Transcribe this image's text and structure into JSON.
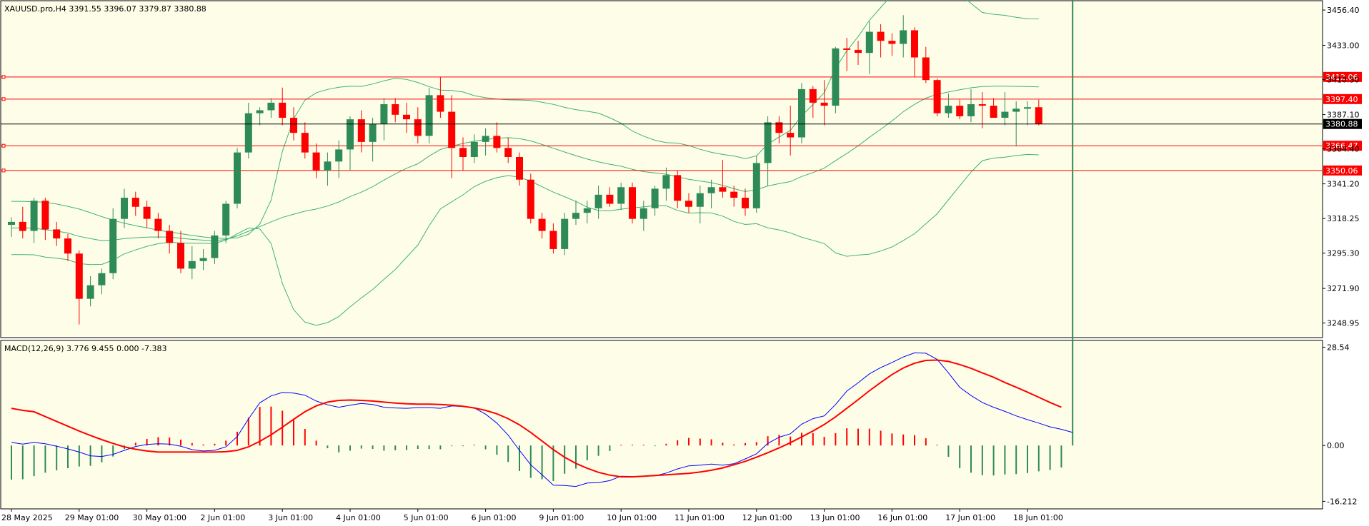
{
  "window": {
    "symbol_info": "XAUUSD.pro,H4  3391.55 3396.07 3379.87 3380.88",
    "macd_info": "MACD(12,26,9) 3.776 9.455 0.000 -7.383"
  },
  "colors": {
    "background": "#fefee8",
    "bull": "#2e8b57",
    "bear": "#ff0000",
    "band": "#3cb371",
    "level": "#ff0000",
    "price_line": "#000000",
    "macd_line": "#0000ff",
    "signal_line": "#ff0000"
  },
  "chart_data": [
    {
      "type": "candlestick",
      "title": "XAUUSD.pro,H4",
      "ylim": [
        3239.3,
        3462.6
      ],
      "y_ticks": [
        "3456.40",
        "3433.00",
        "3410.30",
        "3387.10",
        "3364.40",
        "3341.20",
        "3318.25",
        "3295.30",
        "3271.90",
        "3248.95"
      ],
      "x_ticks": [
        "28 May 2025",
        "29 May 01:00",
        "30 May 01:00",
        "2 Jun 01:00",
        "3 Jun 01:00",
        "4 Jun 01:00",
        "5 Jun 01:00",
        "6 Jun 01:00",
        "9 Jun 01:00",
        "10 Jun 01:00",
        "11 Jun 01:00",
        "12 Jun 01:00",
        "13 Jun 01:00",
        "16 Jun 01:00",
        "17 Jun 01:00",
        "18 Jun 01:00"
      ],
      "candles": [
        [
          3314,
          3319,
          3306,
          3316
        ],
        [
          3316,
          3326,
          3305,
          3310
        ],
        [
          3310,
          3332,
          3302,
          3330
        ],
        [
          3330,
          3332,
          3304,
          3311
        ],
        [
          3311,
          3316,
          3300,
          3305
        ],
        [
          3305,
          3308,
          3290,
          3295
        ],
        [
          3295,
          3297,
          3248,
          3265
        ],
        [
          3265,
          3280,
          3260,
          3274
        ],
        [
          3274,
          3285,
          3268,
          3282
        ],
        [
          3282,
          3325,
          3278,
          3318
        ],
        [
          3318,
          3338,
          3312,
          3332
        ],
        [
          3332,
          3336,
          3320,
          3326
        ],
        [
          3326,
          3330,
          3312,
          3318
        ],
        [
          3318,
          3322,
          3305,
          3310
        ],
        [
          3310,
          3314,
          3295,
          3302
        ],
        [
          3302,
          3310,
          3282,
          3285
        ],
        [
          3285,
          3300,
          3278,
          3290
        ],
        [
          3290,
          3298,
          3284,
          3292
        ],
        [
          3292,
          3310,
          3288,
          3307
        ],
        [
          3307,
          3330,
          3302,
          3328
        ],
        [
          3328,
          3365,
          3325,
          3362
        ],
        [
          3362,
          3395,
          3358,
          3388
        ],
        [
          3388,
          3392,
          3380,
          3390
        ],
        [
          3390,
          3398,
          3385,
          3395
        ],
        [
          3395,
          3405,
          3380,
          3385
        ],
        [
          3385,
          3392,
          3370,
          3375
        ],
        [
          3375,
          3382,
          3358,
          3362
        ],
        [
          3362,
          3368,
          3345,
          3350
        ],
        [
          3350,
          3362,
          3340,
          3356
        ],
        [
          3356,
          3370,
          3345,
          3364
        ],
        [
          3364,
          3386,
          3350,
          3384
        ],
        [
          3384,
          3390,
          3362,
          3369
        ],
        [
          3369,
          3385,
          3356,
          3381
        ],
        [
          3381,
          3398,
          3370,
          3394
        ],
        [
          3394,
          3398,
          3382,
          3387
        ],
        [
          3387,
          3395,
          3375,
          3384
        ],
        [
          3384,
          3392,
          3368,
          3373
        ],
        [
          3373,
          3405,
          3368,
          3400
        ],
        [
          3400,
          3412,
          3385,
          3389
        ],
        [
          3389,
          3400,
          3345,
          3365
        ],
        [
          3365,
          3372,
          3350,
          3359
        ],
        [
          3359,
          3374,
          3355,
          3369
        ],
        [
          3369,
          3378,
          3360,
          3373
        ],
        [
          3373,
          3382,
          3362,
          3365
        ],
        [
          3365,
          3372,
          3355,
          3359
        ],
        [
          3359,
          3362,
          3340,
          3344
        ],
        [
          3344,
          3348,
          3315,
          3318
        ],
        [
          3318,
          3322,
          3305,
          3310
        ],
        [
          3310,
          3315,
          3295,
          3298
        ],
        [
          3298,
          3322,
          3294,
          3318
        ],
        [
          3318,
          3330,
          3314,
          3322
        ],
        [
          3322,
          3330,
          3315,
          3325
        ],
        [
          3325,
          3340,
          3318,
          3334
        ],
        [
          3334,
          3339,
          3326,
          3328
        ],
        [
          3328,
          3342,
          3324,
          3339
        ],
        [
          3339,
          3342,
          3315,
          3318
        ],
        [
          3318,
          3330,
          3310,
          3325
        ],
        [
          3325,
          3340,
          3320,
          3338
        ],
        [
          3338,
          3352,
          3330,
          3347
        ],
        [
          3347,
          3350,
          3325,
          3330
        ],
        [
          3330,
          3335,
          3322,
          3326
        ],
        [
          3326,
          3340,
          3315,
          3335
        ],
        [
          3335,
          3344,
          3325,
          3339
        ],
        [
          3339,
          3357,
          3332,
          3336
        ],
        [
          3336,
          3340,
          3326,
          3332
        ],
        [
          3332,
          3338,
          3320,
          3325
        ],
        [
          3325,
          3360,
          3322,
          3355
        ],
        [
          3355,
          3386,
          3340,
          3382
        ],
        [
          3382,
          3386,
          3368,
          3375
        ],
        [
          3375,
          3393,
          3360,
          3372
        ],
        [
          3372,
          3408,
          3368,
          3404
        ],
        [
          3404,
          3406,
          3385,
          3395
        ],
        [
          3395,
          3410,
          3380,
          3393
        ],
        [
          3393,
          3432,
          3388,
          3431
        ],
        [
          3431,
          3438,
          3416,
          3430
        ],
        [
          3430,
          3436,
          3420,
          3428
        ],
        [
          3428,
          3449,
          3414,
          3442
        ],
        [
          3442,
          3447,
          3425,
          3436
        ],
        [
          3436,
          3441,
          3426,
          3434
        ],
        [
          3434,
          3453,
          3425,
          3443
        ],
        [
          3443,
          3445,
          3412,
          3425
        ],
        [
          3425,
          3432,
          3408,
          3410
        ],
        [
          3410,
          3411,
          3386,
          3388
        ],
        [
          3388,
          3401,
          3385,
          3393
        ],
        [
          3393,
          3397,
          3384,
          3386
        ],
        [
          3386,
          3404,
          3382,
          3394
        ],
        [
          3394,
          3402,
          3378,
          3393
        ],
        [
          3393,
          3398,
          3385,
          3385
        ],
        [
          3385,
          3402,
          3380,
          3389
        ],
        [
          3389,
          3396,
          3366,
          3391
        ],
        [
          3391,
          3396,
          3380,
          3392
        ],
        [
          3392,
          3397,
          3380,
          3381
        ]
      ],
      "bollinger": {
        "upper": [
          3329.6,
          3329.6,
          3329.3,
          3329,
          3327.8,
          3326.3,
          3324.5,
          3322.1,
          3319.5,
          3317.1,
          3315.1,
          3313.5,
          3312,
          3310.5,
          3309.3,
          3308.2,
          3307,
          3306,
          3305.3,
          3305,
          3305.4,
          3307.7,
          3314.5,
          3330.3,
          3362.7,
          3384.4,
          3396.7,
          3401.6,
          3403.8,
          3405.2,
          3405.9,
          3405.8,
          3407.4,
          3409.5,
          3411.2,
          3410.4,
          3408.4,
          3405.7,
          3403.3,
          3403.1,
          3402.1,
          3399.7,
          3398.3,
          3397.4,
          3396.9,
          3396.8,
          3396.5,
          3395.3,
          3393.9,
          3391.9,
          3390.4,
          3389.3,
          3388.1,
          3385,
          3381.4,
          3376.2,
          3372.8,
          3370.1,
          3368.5,
          3368.2,
          3366.6,
          3364.1,
          3362.1,
          3360.7,
          3359.7,
          3357.9,
          3359.8,
          3367.6,
          3372.2,
          3376.7,
          3386.4,
          3393.7,
          3401.6,
          3417.8,
          3429.4,
          3438.8,
          3449.6,
          3458.1,
          3466.4,
          3474.4,
          3479.7,
          3481.3,
          3479.8,
          3473.6,
          3467.3,
          3460.8,
          3454.8,
          3453.6,
          3452.9,
          3451.6,
          3450.7,
          3450.6
        ],
        "middle": [
          3311.9,
          3312,
          3311.8,
          3310.8,
          3309.9,
          3308.6,
          3306.4,
          3304.9,
          3303.6,
          3303.9,
          3304.9,
          3305.5,
          3305.9,
          3306,
          3305.9,
          3305.1,
          3304.4,
          3303.9,
          3303.5,
          3304.4,
          3306.7,
          3309.8,
          3312.9,
          3316,
          3318.9,
          3321.1,
          3323.1,
          3324.5,
          3326.5,
          3329.2,
          3332.8,
          3335.7,
          3339.3,
          3343.7,
          3347.8,
          3351.5,
          3354.5,
          3359.6,
          3364,
          3366.2,
          3368,
          3369.5,
          3370.6,
          3371.4,
          3371.8,
          3371.2,
          3369.7,
          3367.3,
          3364.8,
          3362.3,
          3359.9,
          3357.6,
          3355.8,
          3354.2,
          3352.9,
          3350.8,
          3349.3,
          3348.5,
          3347.6,
          3345.9,
          3344.2,
          3343.1,
          3342,
          3340.2,
          3338,
          3336.1,
          3337.3,
          3339.8,
          3341.4,
          3342.7,
          3346.1,
          3348.7,
          3351.6,
          3356.6,
          3361.3,
          3366.4,
          3372.1,
          3377.4,
          3382.9,
          3389,
          3393.9,
          3398,
          3400.6,
          3402.1,
          3403.6,
          3404.9,
          3405.7,
          3405.9,
          3405.9,
          3405.8,
          3405.7,
          3405.5
        ],
        "lower": [
          3294.3,
          3294.3,
          3294.2,
          3292.6,
          3291.9,
          3290.9,
          3288.3,
          3287.7,
          3287.8,
          3290.7,
          3294.8,
          3297.4,
          3299.8,
          3301.5,
          3302.5,
          3302,
          3301.8,
          3301.8,
          3301.7,
          3303.9,
          3308.1,
          3311.9,
          3311.3,
          3301.7,
          3275.2,
          3257.8,
          3249.5,
          3247.4,
          3249.2,
          3253.3,
          3259.7,
          3265.6,
          3271.2,
          3277.9,
          3284.4,
          3292.5,
          3300.6,
          3313.4,
          3324.6,
          3329.3,
          3333.9,
          3339.4,
          3342.9,
          3345.3,
          3346.7,
          3345.6,
          3342.9,
          3339.3,
          3335.7,
          3332.7,
          3329.5,
          3325.8,
          3323.5,
          3323.4,
          3324.4,
          3325.3,
          3325.9,
          3326.8,
          3326.7,
          3323.6,
          3321.8,
          3322.1,
          3321.9,
          3319.8,
          3316.3,
          3314.3,
          3314.8,
          3312,
          3310.7,
          3308.7,
          3305.8,
          3303.8,
          3301.6,
          3295.4,
          3293.2,
          3294,
          3294.6,
          3296.7,
          3299.4,
          3303.6,
          3308.2,
          3314.7,
          3321.4,
          3330.6,
          3339.9,
          3349,
          3356.6,
          3358.3,
          3358.9,
          3360,
          3360.7,
          3360.4
        ]
      },
      "levels": [
        {
          "value": 3412.06,
          "label": "3412.06",
          "color": "red"
        },
        {
          "value": 3397.4,
          "label": "3397.40",
          "color": "red"
        },
        {
          "value": 3366.47,
          "label": "3366.47",
          "color": "red"
        },
        {
          "value": 3350.06,
          "label": "3350.06",
          "color": "red"
        }
      ],
      "current_price": {
        "value": 3380.88,
        "label": "3380.88"
      }
    },
    {
      "type": "line+bar",
      "title": "MACD(12,26,9)",
      "ylim": [
        -18.4,
        30.5
      ],
      "y_ticks": [
        "28.54",
        "0.00",
        "-16.212"
      ],
      "macd": [
        0.9,
        0.4,
        0.9,
        0.5,
        -0.2,
        -1,
        -1.9,
        -3,
        -3.2,
        -2.6,
        -1.4,
        -0.3,
        0.3,
        0.5,
        0.4,
        -0.2,
        -1.2,
        -1.6,
        -1.4,
        -0.4,
        2.6,
        7.7,
        12.4,
        14.4,
        15.4,
        15.2,
        14.6,
        12.9,
        11.8,
        11.1,
        11.7,
        12.2,
        11.9,
        11.1,
        10.9,
        10.8,
        11,
        11,
        10.8,
        11.5,
        11.3,
        10.9,
        9.1,
        6.5,
        3,
        -1.4,
        -5.6,
        -8.5,
        -11.5,
        -11.6,
        -11.9,
        -10.9,
        -10.8,
        -10.2,
        -8.9,
        -9,
        -8.9,
        -8.8,
        -8,
        -6.8,
        -5.9,
        -5.7,
        -5.4,
        -5.7,
        -5.3,
        -3.9,
        -2.4,
        0.6,
        2.4,
        3.4,
        6.2,
        7.8,
        8.6,
        11.9,
        15.8,
        18.2,
        20.8,
        22.6,
        24.1,
        25.7,
        26.9,
        26.8,
        25,
        21.1,
        16.9,
        14.5,
        12.5,
        11.1,
        9.9,
        8.6,
        7.5,
        6.5,
        5.4,
        4.7,
        3.8
      ],
      "signal": [
        10.8,
        10.2,
        9.8,
        8.4,
        7,
        5.6,
        4.2,
        2.9,
        1.7,
        0.6,
        -0.4,
        -1.1,
        -1.6,
        -1.9,
        -1.9,
        -1.9,
        -1.9,
        -1.9,
        -1.9,
        -1.8,
        -1.4,
        -0.4,
        1.2,
        3.1,
        5.3,
        7.6,
        9.8,
        11.5,
        12.6,
        13.1,
        13.2,
        13.1,
        12.9,
        12.6,
        12.3,
        12.1,
        12,
        12,
        11.9,
        11.7,
        11.4,
        10.9,
        10.2,
        9.2,
        7.8,
        6,
        3.8,
        1.3,
        -1.2,
        -3.4,
        -5.2,
        -6.6,
        -7.8,
        -8.6,
        -9.1,
        -9.1,
        -8.9,
        -8.7,
        -8.5,
        -8.3,
        -8.1,
        -7.7,
        -7.2,
        -6.5,
        -5.6,
        -4.6,
        -3.4,
        -2.1,
        -0.7,
        0.8,
        2.5,
        4.2,
        6.1,
        8.3,
        10.8,
        13.3,
        15.9,
        18.3,
        20.6,
        22.5,
        23.9,
        24.7,
        24.8,
        24.4,
        23.5,
        22.4,
        21.1,
        19.8,
        18.3,
        16.9,
        15.5,
        14,
        12.5,
        11.1
      ]
    }
  ]
}
